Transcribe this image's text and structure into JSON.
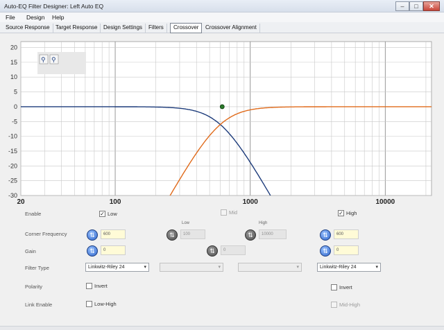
{
  "window": {
    "title": "Auto-EQ Filter Designer: Left Auto EQ",
    "buttons": {
      "minimize": "–",
      "maximize": "□",
      "close": "✕"
    }
  },
  "menu": {
    "items": [
      "File",
      "Design",
      "Help"
    ]
  },
  "tabs": {
    "items": [
      "Source Response",
      "Target Response",
      "Design Settings",
      "Filters",
      "Crossover",
      "Crossover Alignment"
    ],
    "active": "Crossover"
  },
  "toolbar": {
    "zoom_in_icon": "zoom-in-icon",
    "zoom_out_icon": "zoom-out-icon"
  },
  "chart_data": {
    "type": "line",
    "xscale": "log",
    "xlim": [
      20,
      22000
    ],
    "ylim": [
      -30,
      22
    ],
    "yticks": [
      "20",
      "15",
      "10",
      "5",
      "0",
      "-5",
      "-10",
      "-15",
      "-20",
      "-25",
      "-30"
    ],
    "xticks": [
      "20",
      "100",
      "1000",
      "10000"
    ],
    "grid": true,
    "series": [
      {
        "role": "lowpass",
        "color": "#1b3a7a",
        "corner_hz": 600,
        "order": 4,
        "x": [
          20,
          100,
          200,
          300,
          400,
          500,
          600,
          700,
          800,
          1000,
          1200,
          1400
        ],
        "y": [
          0,
          0,
          0,
          -0.3,
          -1.2,
          -3.2,
          -6.0,
          -9.1,
          -12.0,
          -17.6,
          -22.4,
          -26.8
        ]
      },
      {
        "role": "highpass",
        "color": "#e06a1a",
        "corner_hz": 600,
        "order": 4,
        "x": [
          250,
          300,
          400,
          500,
          600,
          700,
          800,
          1000,
          1500,
          2000,
          3000,
          20000
        ],
        "y": [
          -30.0,
          -24.8,
          -15.2,
          -9.4,
          -6.0,
          -3.6,
          -2.1,
          -0.7,
          -0.1,
          0,
          0,
          0
        ]
      }
    ],
    "marker": {
      "x_hz": 620,
      "y_db": 0,
      "color": "#2a7a2a"
    }
  },
  "controls": {
    "labels": {
      "enable": "Enable",
      "corner_frequency": "Corner Frequency",
      "gain": "Gain",
      "filter_type": "Filter Type",
      "polarity": "Polarity",
      "link_enable": "Link Enable"
    },
    "enable": {
      "low": "Low",
      "low_checked": true,
      "mid": "Mid",
      "mid_checked": false,
      "high": "High",
      "high_checked": true
    },
    "corner_frequency": {
      "low_value": "600",
      "mid_low_caption": "Low",
      "mid_low_value": "100",
      "mid_high_caption": "High",
      "mid_high_value": "10000",
      "high_value": "600"
    },
    "gain": {
      "low_value": "0",
      "mid_value": "0",
      "high_value": "0"
    },
    "filter_type": {
      "low": "Linkwitz-Riley 24",
      "mid1": "",
      "mid2": "",
      "high": "Linkwitz-Riley 24"
    },
    "polarity": {
      "low_invert": "Invert",
      "high_invert": "Invert"
    },
    "link_enable": {
      "low_high": "Low-High",
      "mid_high": "Mid-High"
    },
    "check_glyph": "✓",
    "knob_glyph": "⇅",
    "dropdown_glyph": "▾"
  }
}
